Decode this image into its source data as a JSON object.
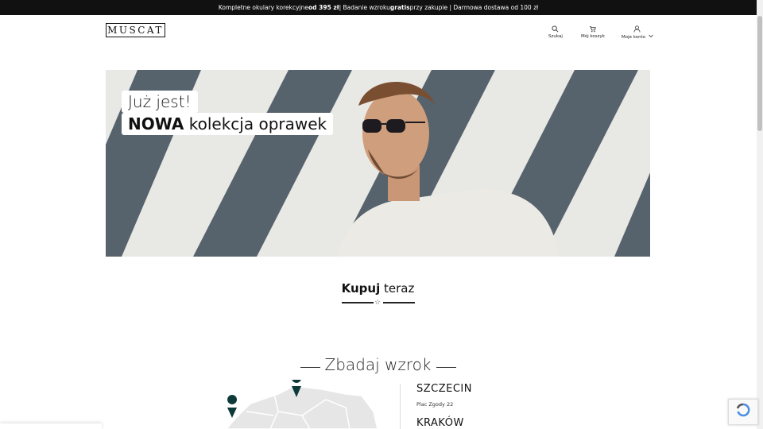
{
  "topbar": {
    "part1": "Kompletne okulary korekcyjne ",
    "bold1": "od 395 zł",
    "part2": " | Badanie wzroku ",
    "bold2": "gratis",
    "part3": " przy zakupie | Darmowa dostawa od 100 zł"
  },
  "header": {
    "logo_text": "MUSCAT",
    "search_label": "Szukaj",
    "cart_label": "Mój koszyk",
    "account_label": "Moje konto",
    "search_icon": "search-icon",
    "cart_icon": "cart-icon",
    "account_icon": "user-icon"
  },
  "hero": {
    "line1": "Już jest!",
    "line2_bold": "NOWA",
    "line2_rest": " kolekcja oprawek"
  },
  "shop_section": {
    "title_bold": "Kupuj",
    "title_rest": " teraz",
    "star_glyph": "☆"
  },
  "exam_section": {
    "title": "Zbadaj wzrok",
    "locations": [
      {
        "city": "SZCZECIN",
        "address": "Plac Zgody 22"
      },
      {
        "city": "KRAKÓW",
        "address": ""
      }
    ]
  },
  "colors": {
    "topbar_bg": "#111111",
    "pin": "#0f3a3a",
    "stripe_dark": "#56626c",
    "stripe_light": "#e8e8e4"
  }
}
